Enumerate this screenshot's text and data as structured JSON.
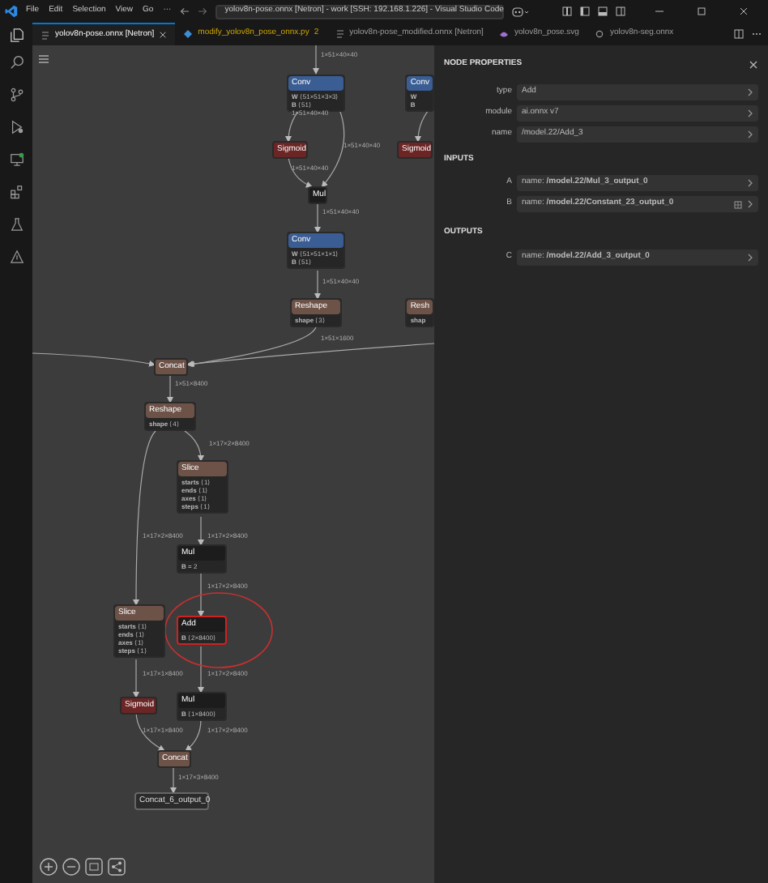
{
  "window": {
    "title": "yolov8n-pose.onnx [Netron] - work [SSH: 192.168.1.226] - Visual Studio Code",
    "menu": [
      "File",
      "Edit",
      "Selection",
      "View",
      "Go",
      "···"
    ]
  },
  "tabs": [
    {
      "label": "yolov8n-pose.onnx [Netron]",
      "selected": true,
      "warning": false
    },
    {
      "label": "modify_yolov8n_pose_onnx.py",
      "count": "2",
      "selected": false,
      "warning": true
    },
    {
      "label": "yolov8n-pose_modified.onnx [Netron]",
      "selected": false,
      "warning": false
    },
    {
      "label": "yolov8n_pose.svg",
      "selected": false,
      "warning": false
    },
    {
      "label": "yolov8n-seg.onnx",
      "selected": false,
      "warning": false
    }
  ],
  "graph": {
    "nodes": [
      {
        "title": "Conv",
        "kind": "conv",
        "selected": false,
        "attributes": [
          {
            "name": "W",
            "value": "⟨51×51×3×3⟩"
          },
          {
            "name": "B",
            "value": "⟨51⟩"
          }
        ]
      },
      {
        "title": "Conv",
        "kind": "conv",
        "selected": false,
        "attributes": [
          {
            "name": "W"
          },
          {
            "name": "B"
          }
        ]
      },
      {
        "title": "Sigmoid",
        "kind": "activation",
        "selected": false
      },
      {
        "title": "Sigmoid",
        "kind": "activation",
        "selected": false
      },
      {
        "title": "Mul",
        "kind": "math",
        "selected": false
      },
      {
        "title": "Conv",
        "kind": "conv",
        "selected": false,
        "attributes": [
          {
            "name": "W",
            "value": "⟨51×51×1×1⟩"
          },
          {
            "name": "B",
            "value": "⟨51⟩"
          }
        ]
      },
      {
        "title": "Reshape",
        "kind": "shape",
        "selected": false,
        "attributes": [
          {
            "name": "shape",
            "value": "⟨3⟩"
          }
        ]
      },
      {
        "title": "Resh",
        "kind": "shape",
        "selected": false,
        "attributes": [
          {
            "name": "shap"
          }
        ]
      },
      {
        "title": "Concat",
        "kind": "shape",
        "selected": false
      },
      {
        "title": "Reshape",
        "kind": "shape",
        "selected": false,
        "attributes": [
          {
            "name": "shape",
            "value": "⟨4⟩"
          }
        ]
      },
      {
        "title": "Slice",
        "kind": "shape",
        "selected": false,
        "attributes": [
          {
            "name": "starts",
            "value": "⟨1⟩"
          },
          {
            "name": "ends",
            "value": "⟨1⟩"
          },
          {
            "name": "axes",
            "value": "⟨1⟩"
          },
          {
            "name": "steps",
            "value": "⟨1⟩"
          }
        ]
      },
      {
        "title": "Mul",
        "kind": "math",
        "selected": false,
        "attributes": [
          {
            "name": "B",
            "value": "= 2"
          }
        ]
      },
      {
        "title": "Slice",
        "kind": "shape",
        "selected": false,
        "attributes": [
          {
            "name": "starts",
            "value": "⟨1⟩"
          },
          {
            "name": "ends",
            "value": "⟨1⟩"
          },
          {
            "name": "axes",
            "value": "⟨1⟩"
          },
          {
            "name": "steps",
            "value": "⟨1⟩"
          }
        ]
      },
      {
        "title": "Add",
        "kind": "math",
        "selected": true,
        "attributes": [
          {
            "name": "B",
            "value": "⟨2×8400⟩"
          }
        ]
      },
      {
        "title": "Sigmoid",
        "kind": "activation",
        "selected": false
      },
      {
        "title": "Mul",
        "kind": "math",
        "selected": false,
        "attributes": [
          {
            "name": "B",
            "value": "⟨1×8400⟩"
          }
        ]
      },
      {
        "title": "Concat",
        "kind": "shape",
        "selected": false
      },
      {
        "title": "Concat_6_output_0",
        "kind": "output",
        "selected": false
      }
    ],
    "edges": [
      {
        "label": "1×51×40×40"
      },
      {
        "label": "1×51×40×40"
      },
      {
        "label": "1×51×40×40"
      },
      {
        "label": "1×51×40×40"
      },
      {
        "label": "1×51×40×40"
      },
      {
        "label": "1×51×40×40"
      },
      {
        "label": "1×51×1600"
      },
      {
        "label": "1×51×8400"
      },
      {
        "label": "1×17×2×8400"
      },
      {
        "label": "1×17×2×8400"
      },
      {
        "label": "1×17×2×8400"
      },
      {
        "label": "1×17×2×8400"
      },
      {
        "label": "1×17×1×8400"
      },
      {
        "label": "1×17×2×8400"
      },
      {
        "label": "1×17×1×8400"
      },
      {
        "label": "1×17×2×8400"
      },
      {
        "label": "1×17×3×8400"
      }
    ]
  },
  "properties": {
    "title": "NODE PROPERTIES",
    "fields": [
      {
        "label": "type",
        "value": "Add"
      },
      {
        "label": "module",
        "value": "ai.onnx v7"
      },
      {
        "label": "name",
        "value": "/model.22/Add_3"
      }
    ],
    "sections": [
      {
        "title": "INPUTS",
        "items": [
          {
            "label": "A",
            "value": "name: **/model.22/Mul_3_output_0**"
          },
          {
            "label": "B",
            "value": "name: **/model.22/Constant_23_output_0**",
            "extra": true
          }
        ]
      },
      {
        "title": "OUTPUTS",
        "items": [
          {
            "label": "C",
            "value": "name: **/model.22/Add_3_output_0**"
          }
        ]
      }
    ]
  }
}
